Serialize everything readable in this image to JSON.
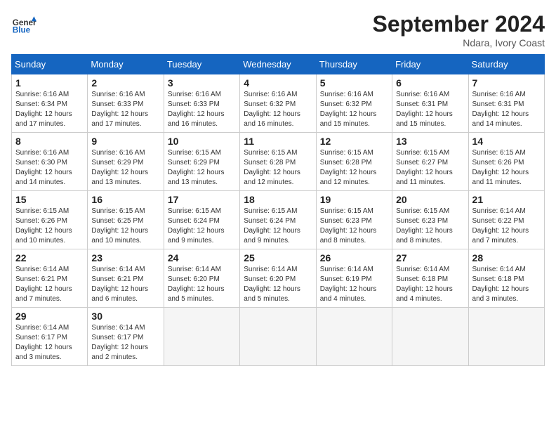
{
  "header": {
    "logo_general": "General",
    "logo_blue": "Blue",
    "month": "September 2024",
    "location": "Ndara, Ivory Coast"
  },
  "columns": [
    "Sunday",
    "Monday",
    "Tuesday",
    "Wednesday",
    "Thursday",
    "Friday",
    "Saturday"
  ],
  "weeks": [
    [
      {
        "day": "1",
        "info": "Sunrise: 6:16 AM\nSunset: 6:34 PM\nDaylight: 12 hours\nand 17 minutes."
      },
      {
        "day": "2",
        "info": "Sunrise: 6:16 AM\nSunset: 6:33 PM\nDaylight: 12 hours\nand 17 minutes."
      },
      {
        "day": "3",
        "info": "Sunrise: 6:16 AM\nSunset: 6:33 PM\nDaylight: 12 hours\nand 16 minutes."
      },
      {
        "day": "4",
        "info": "Sunrise: 6:16 AM\nSunset: 6:32 PM\nDaylight: 12 hours\nand 16 minutes."
      },
      {
        "day": "5",
        "info": "Sunrise: 6:16 AM\nSunset: 6:32 PM\nDaylight: 12 hours\nand 15 minutes."
      },
      {
        "day": "6",
        "info": "Sunrise: 6:16 AM\nSunset: 6:31 PM\nDaylight: 12 hours\nand 15 minutes."
      },
      {
        "day": "7",
        "info": "Sunrise: 6:16 AM\nSunset: 6:31 PM\nDaylight: 12 hours\nand 14 minutes."
      }
    ],
    [
      {
        "day": "8",
        "info": "Sunrise: 6:16 AM\nSunset: 6:30 PM\nDaylight: 12 hours\nand 14 minutes."
      },
      {
        "day": "9",
        "info": "Sunrise: 6:16 AM\nSunset: 6:29 PM\nDaylight: 12 hours\nand 13 minutes."
      },
      {
        "day": "10",
        "info": "Sunrise: 6:15 AM\nSunset: 6:29 PM\nDaylight: 12 hours\nand 13 minutes."
      },
      {
        "day": "11",
        "info": "Sunrise: 6:15 AM\nSunset: 6:28 PM\nDaylight: 12 hours\nand 12 minutes."
      },
      {
        "day": "12",
        "info": "Sunrise: 6:15 AM\nSunset: 6:28 PM\nDaylight: 12 hours\nand 12 minutes."
      },
      {
        "day": "13",
        "info": "Sunrise: 6:15 AM\nSunset: 6:27 PM\nDaylight: 12 hours\nand 11 minutes."
      },
      {
        "day": "14",
        "info": "Sunrise: 6:15 AM\nSunset: 6:26 PM\nDaylight: 12 hours\nand 11 minutes."
      }
    ],
    [
      {
        "day": "15",
        "info": "Sunrise: 6:15 AM\nSunset: 6:26 PM\nDaylight: 12 hours\nand 10 minutes."
      },
      {
        "day": "16",
        "info": "Sunrise: 6:15 AM\nSunset: 6:25 PM\nDaylight: 12 hours\nand 10 minutes."
      },
      {
        "day": "17",
        "info": "Sunrise: 6:15 AM\nSunset: 6:24 PM\nDaylight: 12 hours\nand 9 minutes."
      },
      {
        "day": "18",
        "info": "Sunrise: 6:15 AM\nSunset: 6:24 PM\nDaylight: 12 hours\nand 9 minutes."
      },
      {
        "day": "19",
        "info": "Sunrise: 6:15 AM\nSunset: 6:23 PM\nDaylight: 12 hours\nand 8 minutes."
      },
      {
        "day": "20",
        "info": "Sunrise: 6:15 AM\nSunset: 6:23 PM\nDaylight: 12 hours\nand 8 minutes."
      },
      {
        "day": "21",
        "info": "Sunrise: 6:14 AM\nSunset: 6:22 PM\nDaylight: 12 hours\nand 7 minutes."
      }
    ],
    [
      {
        "day": "22",
        "info": "Sunrise: 6:14 AM\nSunset: 6:21 PM\nDaylight: 12 hours\nand 7 minutes."
      },
      {
        "day": "23",
        "info": "Sunrise: 6:14 AM\nSunset: 6:21 PM\nDaylight: 12 hours\nand 6 minutes."
      },
      {
        "day": "24",
        "info": "Sunrise: 6:14 AM\nSunset: 6:20 PM\nDaylight: 12 hours\nand 5 minutes."
      },
      {
        "day": "25",
        "info": "Sunrise: 6:14 AM\nSunset: 6:20 PM\nDaylight: 12 hours\nand 5 minutes."
      },
      {
        "day": "26",
        "info": "Sunrise: 6:14 AM\nSunset: 6:19 PM\nDaylight: 12 hours\nand 4 minutes."
      },
      {
        "day": "27",
        "info": "Sunrise: 6:14 AM\nSunset: 6:18 PM\nDaylight: 12 hours\nand 4 minutes."
      },
      {
        "day": "28",
        "info": "Sunrise: 6:14 AM\nSunset: 6:18 PM\nDaylight: 12 hours\nand 3 minutes."
      }
    ],
    [
      {
        "day": "29",
        "info": "Sunrise: 6:14 AM\nSunset: 6:17 PM\nDaylight: 12 hours\nand 3 minutes."
      },
      {
        "day": "30",
        "info": "Sunrise: 6:14 AM\nSunset: 6:17 PM\nDaylight: 12 hours\nand 2 minutes."
      },
      {
        "day": "",
        "info": ""
      },
      {
        "day": "",
        "info": ""
      },
      {
        "day": "",
        "info": ""
      },
      {
        "day": "",
        "info": ""
      },
      {
        "day": "",
        "info": ""
      }
    ]
  ]
}
